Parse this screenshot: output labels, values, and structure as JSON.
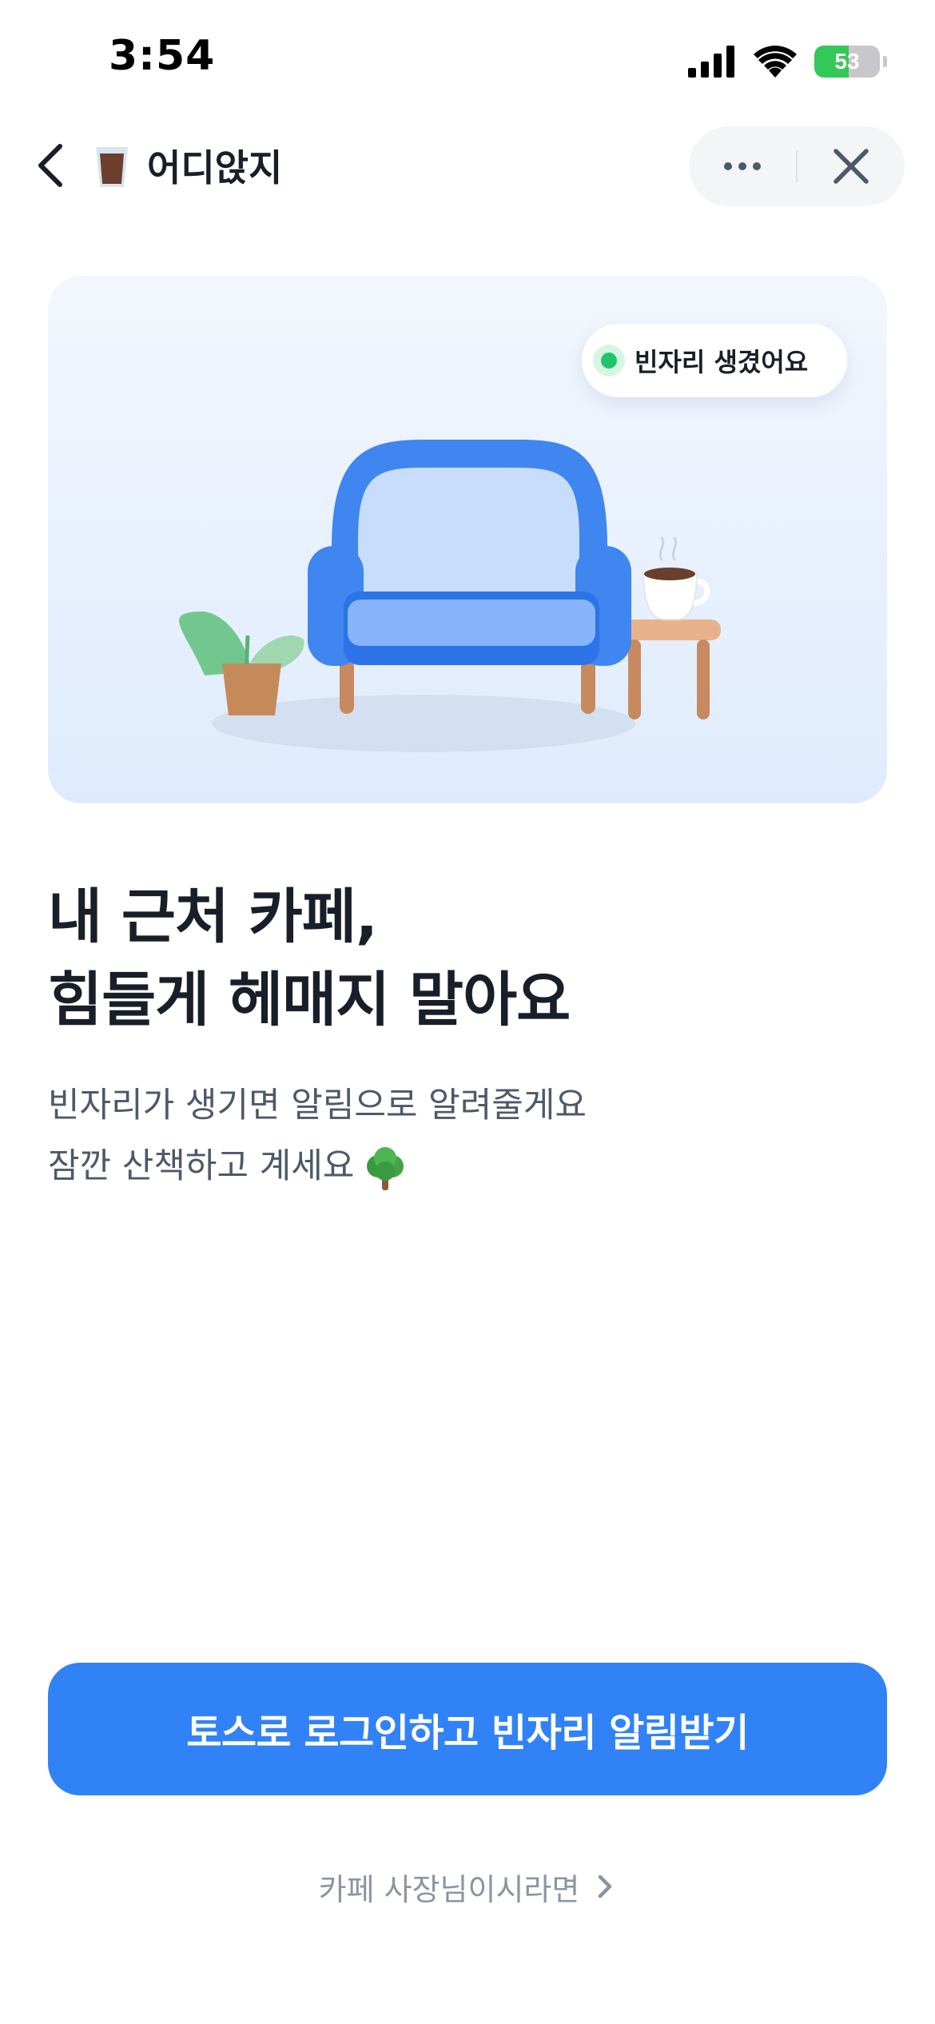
{
  "status_bar": {
    "time": "3:54",
    "battery_level": "53",
    "battery_percent": 53
  },
  "nav": {
    "app_name": "어디앉지",
    "icons": {
      "back": "chevron-left-icon",
      "app": "coffee-cup-icon",
      "more": "more-horizontal-icon",
      "close": "close-icon"
    }
  },
  "hero": {
    "badge_text": "빈자리 생겼어요",
    "badge_dot_color": "#21c46b",
    "illustration": [
      "armchair",
      "plant",
      "side-table",
      "coffee-cup"
    ]
  },
  "content": {
    "headline_lines": [
      "내 근처 카페,",
      "힘들게 헤매지 말아요"
    ],
    "subtitle_lines": [
      "빈자리가 생기면 알림으로 알려줄게요",
      "잠깐 산책하고 계세요"
    ],
    "subtitle_emoji": "tree-icon"
  },
  "actions": {
    "primary_label": "토스로 로그인하고 빈자리 알림받기",
    "owner_link_label": "카페 사장님이시라면"
  },
  "colors": {
    "primary": "#3182f6",
    "text": "#191f28",
    "subtext": "#4e5968",
    "muted": "#8b95a1"
  }
}
